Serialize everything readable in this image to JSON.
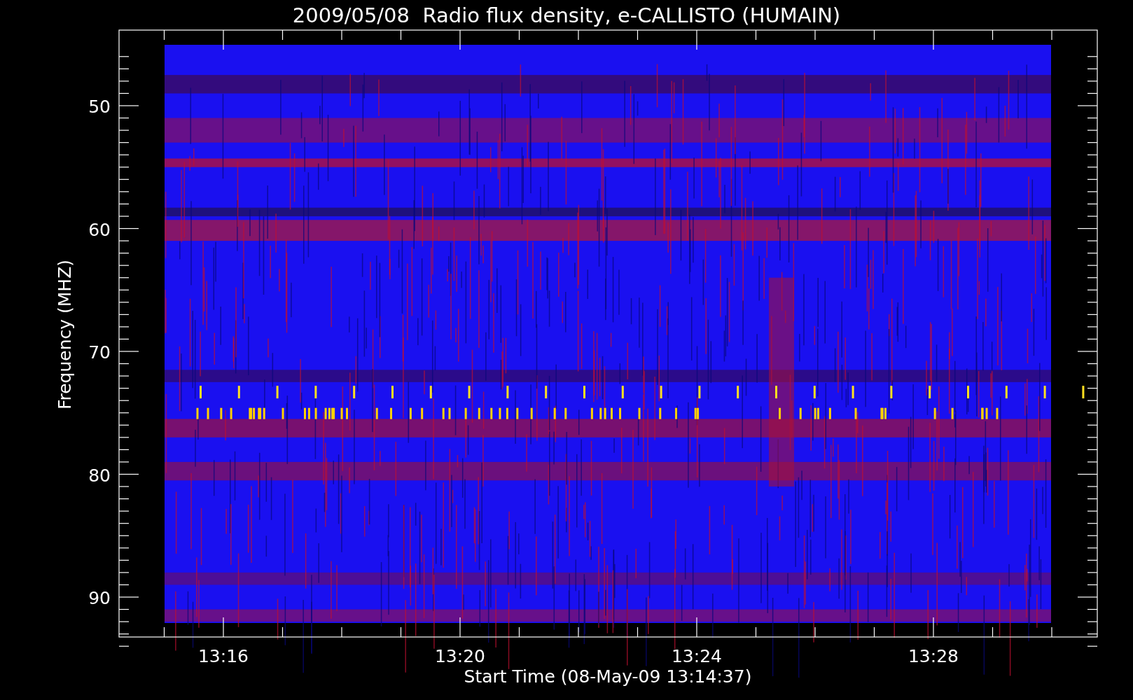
{
  "title": "2009/05/08  Radio flux density, e-CALLISTO (HUMAIN)",
  "y_axis": {
    "label": "Frequency (MHZ)",
    "ticks": [
      "50",
      "60",
      "70",
      "80",
      "90"
    ]
  },
  "x_axis": {
    "label": "Start Time (08-May-09 13:14:37)",
    "ticks": [
      "13:16",
      "13:20",
      "13:24",
      "13:28"
    ]
  }
}
